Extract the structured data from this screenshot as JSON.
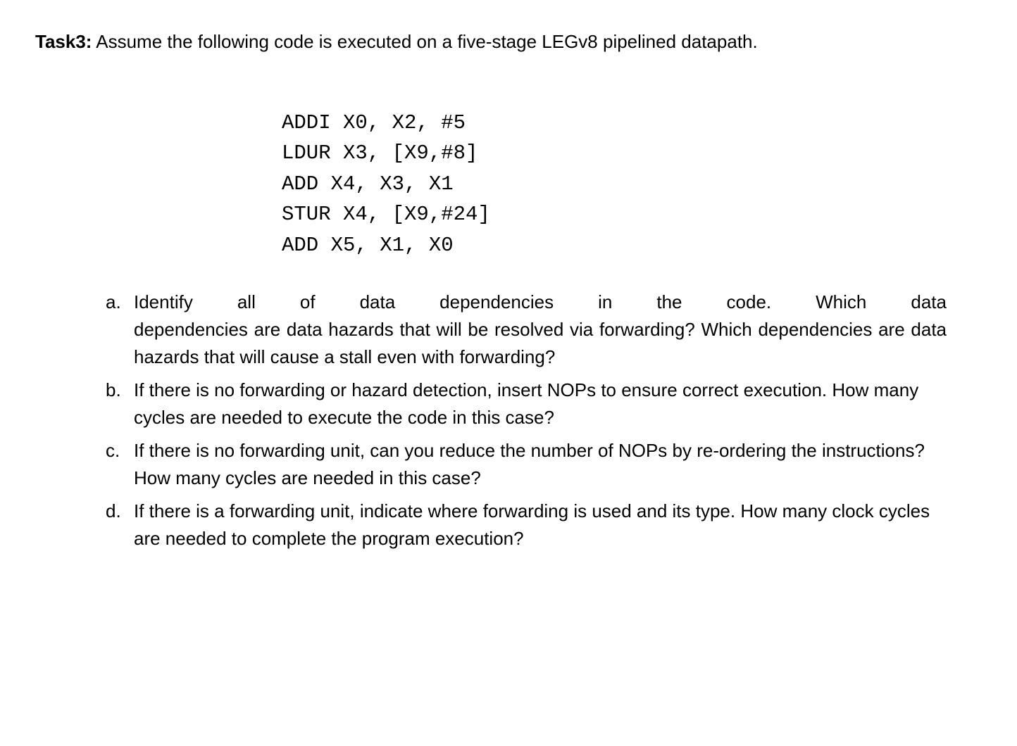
{
  "intro": {
    "task_label": "Task3:",
    "text": " Assume the following code is executed on a five-stage LEGv8 pipelined datapath."
  },
  "code": {
    "lines": [
      "ADDI X0, X2, #5",
      "LDUR X3, [X9,#8]",
      "ADD X4, X3, X1",
      "STUR X4, [X9,#24]",
      "ADD X5, X1, X0"
    ]
  },
  "questions": {
    "a": {
      "letter": "a.",
      "line1": "Identify all of data dependencies in the code. Which data",
      "rest": "dependencies are data hazards that will be resolved via forwarding? Which dependencies are data hazards that will cause a stall even with forwarding?"
    },
    "b": {
      "letter": "b.",
      "text": "If there is no forwarding or hazard detection, insert NOPs to ensure correct execution. How many cycles are needed to execute the code in this case?"
    },
    "c": {
      "letter": "c.",
      "text": "If there is no forwarding unit, can you reduce the number of NOPs by re-ordering the instructions? How many cycles are needed in this case?"
    },
    "d": {
      "letter": "d.",
      "text": "If there is a forwarding unit, indicate where forwarding is used and its type. How many clock cycles are needed to complete the program execution?"
    }
  }
}
